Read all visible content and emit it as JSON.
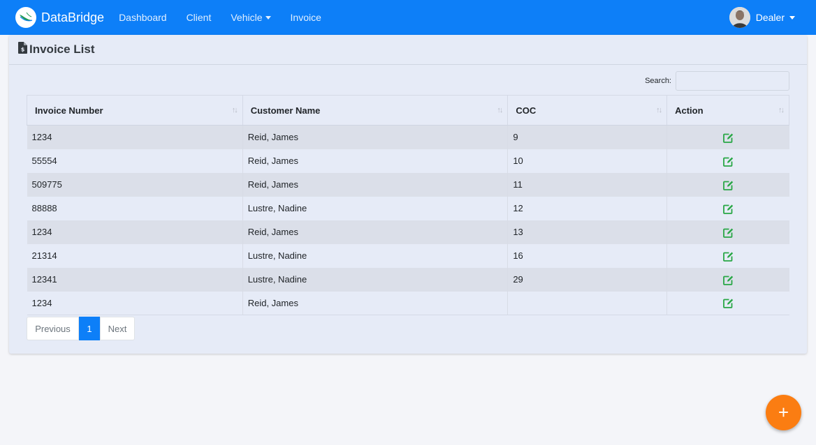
{
  "navbar": {
    "brand": "DataBridge",
    "links": [
      {
        "label": "Dashboard",
        "dropdown": false
      },
      {
        "label": "Client",
        "dropdown": false
      },
      {
        "label": "Vehicle",
        "dropdown": true
      },
      {
        "label": "Invoice",
        "dropdown": false
      }
    ],
    "user": "Dealer",
    "color": "#0d7ff8"
  },
  "card": {
    "icon": "file-invoice-dollar-icon",
    "title": "Invoice List"
  },
  "search": {
    "label": "Search:",
    "value": "",
    "placeholder": ""
  },
  "table": {
    "columns": [
      "Invoice Number",
      "Customer Name",
      "COC",
      "Action"
    ],
    "rows": [
      {
        "invoice": "1234",
        "customer": "Reid, James",
        "coc": "9"
      },
      {
        "invoice": "55554",
        "customer": "Reid, James",
        "coc": "10"
      },
      {
        "invoice": "509775",
        "customer": "Reid, James",
        "coc": "11"
      },
      {
        "invoice": "88888",
        "customer": "Lustre, Nadine",
        "coc": "12"
      },
      {
        "invoice": "1234",
        "customer": "Reid, James",
        "coc": "13"
      },
      {
        "invoice": "21314",
        "customer": "Lustre, Nadine",
        "coc": "16"
      },
      {
        "invoice": "12341",
        "customer": "Lustre, Nadine",
        "coc": "29"
      },
      {
        "invoice": "1234",
        "customer": "Reid, James",
        "coc": ""
      }
    ],
    "action_icon": "edit-icon",
    "action_color": "#28a745"
  },
  "pagination": {
    "previous": "Previous",
    "current": "1",
    "next": "Next",
    "active_color": "#0d7ff8"
  },
  "fab": {
    "label": "+",
    "color": "#fb7d12"
  }
}
